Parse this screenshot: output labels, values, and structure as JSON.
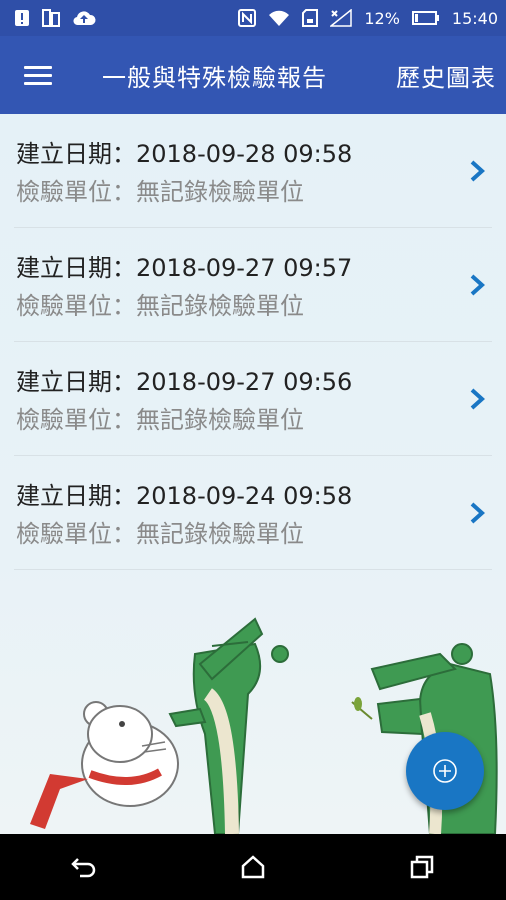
{
  "status_bar": {
    "left_icons": [
      "alert-icon",
      "sim-icon",
      "cloud-upload-icon"
    ],
    "right_icons": [
      "nfc-icon",
      "wifi-icon",
      "sd-card-icon",
      "signal-icon",
      "battery-icon"
    ],
    "battery": "12%",
    "time": "15:40",
    "bg_color": "#2f4fa8"
  },
  "app_bar": {
    "title": "一般與特殊檢驗報告",
    "history_label": "歷史圖表",
    "bg_color": "#3356b3"
  },
  "records": [
    {
      "created": "建立日期：2018-09-28 09:58",
      "unit": "檢驗單位：無記錄檢驗單位"
    },
    {
      "created": "建立日期：2018-09-27 09:57",
      "unit": "檢驗單位：無記錄檢驗單位"
    },
    {
      "created": "建立日期：2018-09-27 09:56",
      "unit": "檢驗單位：無記錄檢驗單位"
    },
    {
      "created": "建立日期：2018-09-24 09:58",
      "unit": "檢驗單位：無記錄檢驗單位"
    }
  ],
  "colors": {
    "chevron": "#1976c4",
    "fab": "#1976c4",
    "crocodile": "#3f9a52"
  },
  "nav_bar": {
    "icons": [
      "back-icon",
      "home-icon",
      "recents-icon"
    ]
  }
}
